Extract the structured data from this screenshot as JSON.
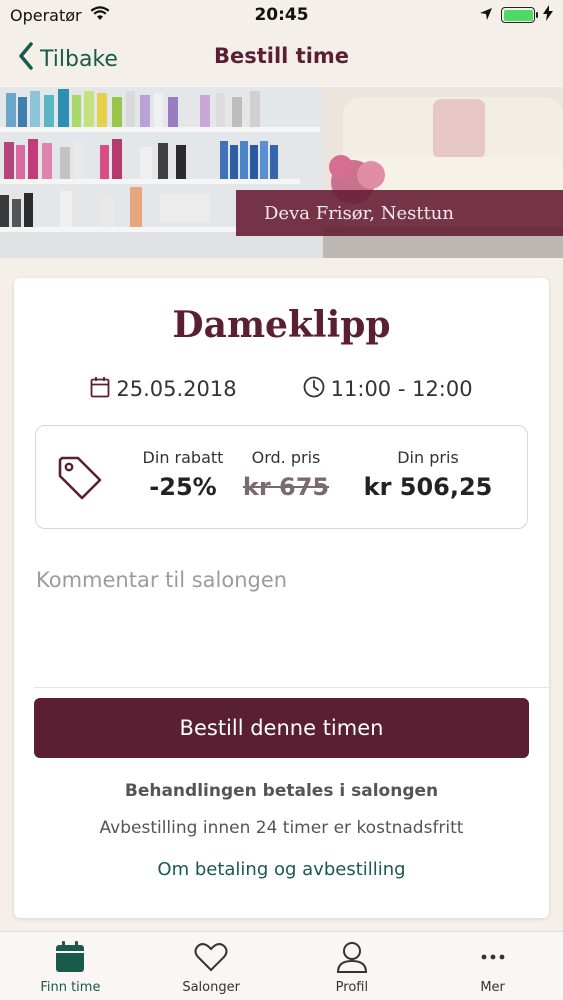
{
  "status_bar": {
    "carrier": "Operatør",
    "time": "20:45"
  },
  "nav": {
    "back_label": "Tilbake",
    "title": "Bestill time"
  },
  "hero": {
    "salon_name": "Deva Frisør, Nesttun"
  },
  "booking": {
    "service": "Dameklipp",
    "date": "25.05.2018",
    "time_range": "11:00 - 12:00",
    "discount_label": "Din rabatt",
    "discount_value": "-25%",
    "ordinary_label": "Ord. pris",
    "ordinary_value": "kr 675",
    "your_price_label": "Din pris",
    "your_price_value": "kr 506,25",
    "comment_placeholder": "Kommentar til salongen",
    "book_button": "Bestill denne timen",
    "payment_note": "Behandlingen betales i salongen",
    "cancel_note": "Avbestilling innen 24 timer er kostnadsfritt",
    "info_link": "Om betaling og avbestilling"
  },
  "tabs": [
    {
      "label": "Finn time",
      "icon": "calendar-icon",
      "active": true
    },
    {
      "label": "Salonger",
      "icon": "heart-icon",
      "active": false
    },
    {
      "label": "Profil",
      "icon": "person-icon",
      "active": false
    },
    {
      "label": "Mer",
      "icon": "more-icon",
      "active": false
    }
  ],
  "colors": {
    "brand": "#5b1f33",
    "accent_green": "#1a5a4a",
    "background": "#f5efea"
  }
}
